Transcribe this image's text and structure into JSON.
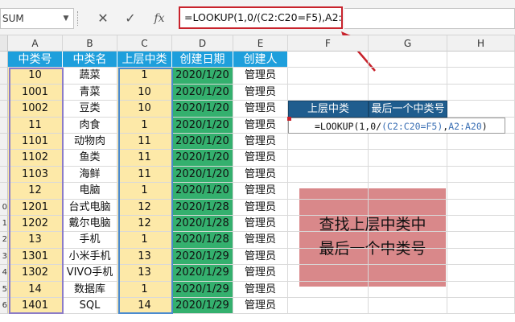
{
  "formula_bar": {
    "name_box": "SUM",
    "cancel_icon": "✕",
    "enter_icon": "✓",
    "fx_label": "fx",
    "formula": "=LOOKUP(1,0/(C2:C20=F5),A2:A20)"
  },
  "columns": [
    "A",
    "B",
    "C",
    "D",
    "E",
    "F",
    "G",
    "H"
  ],
  "row_numbers": [
    "",
    "",
    "",
    "",
    "",
    "",
    "",
    "",
    "",
    "0",
    "1",
    "2",
    "3",
    "4",
    "5",
    "6"
  ],
  "table": {
    "headers": [
      "中类号",
      "中类名",
      "上层中类",
      "创建日期",
      "创建人"
    ],
    "rows": [
      [
        "10",
        "蔬菜",
        "1",
        "2020/1/20",
        "管理员"
      ],
      [
        "1001",
        "青菜",
        "10",
        "2020/1/20",
        "管理员"
      ],
      [
        "1002",
        "豆类",
        "10",
        "2020/1/20",
        "管理员"
      ],
      [
        "11",
        "肉食",
        "1",
        "2020/1/20",
        "管理员"
      ],
      [
        "1101",
        "动物肉",
        "11",
        "2020/1/20",
        "管理员"
      ],
      [
        "1102",
        "鱼类",
        "11",
        "2020/1/20",
        "管理员"
      ],
      [
        "1103",
        "海鲜",
        "11",
        "2020/1/20",
        "管理员"
      ],
      [
        "12",
        "电脑",
        "1",
        "2020/1/20",
        "管理员"
      ],
      [
        "1201",
        "台式电脑",
        "12",
        "2020/1/28",
        "管理员"
      ],
      [
        "1202",
        "戴尔电脑",
        "12",
        "2020/1/28",
        "管理员"
      ],
      [
        "13",
        "手机",
        "1",
        "2020/1/28",
        "管理员"
      ],
      [
        "1301",
        "小米手机",
        "13",
        "2020/1/29",
        "管理员"
      ],
      [
        "1302",
        "VIVO手机",
        "13",
        "2020/1/29",
        "管理员"
      ],
      [
        "14",
        "数据库",
        "1",
        "2020/1/29",
        "管理员"
      ],
      [
        "1401",
        "SQL",
        "14",
        "2020/1/29",
        "管理员"
      ]
    ]
  },
  "lookup": {
    "header_f": "上层中类",
    "header_g": "最后一个中类号",
    "formula_prefix": "=LOOKUP(1,0/",
    "formula_ref_c": "(C2:C20=F5)",
    "formula_sep": ",",
    "formula_ref_a": "A2:A20",
    "formula_suffix": ")"
  },
  "note": {
    "line1": "查找上层中类中",
    "line2": "最后一个中类号"
  },
  "colors": {
    "header_blue": "#1e9fdc",
    "code_col_yellow": "#fde9a8",
    "date_col_green": "#34b06e",
    "lookup_header": "#1f5d8e",
    "note_bg": "#d9888a",
    "highlight_red": "#c8232c"
  }
}
